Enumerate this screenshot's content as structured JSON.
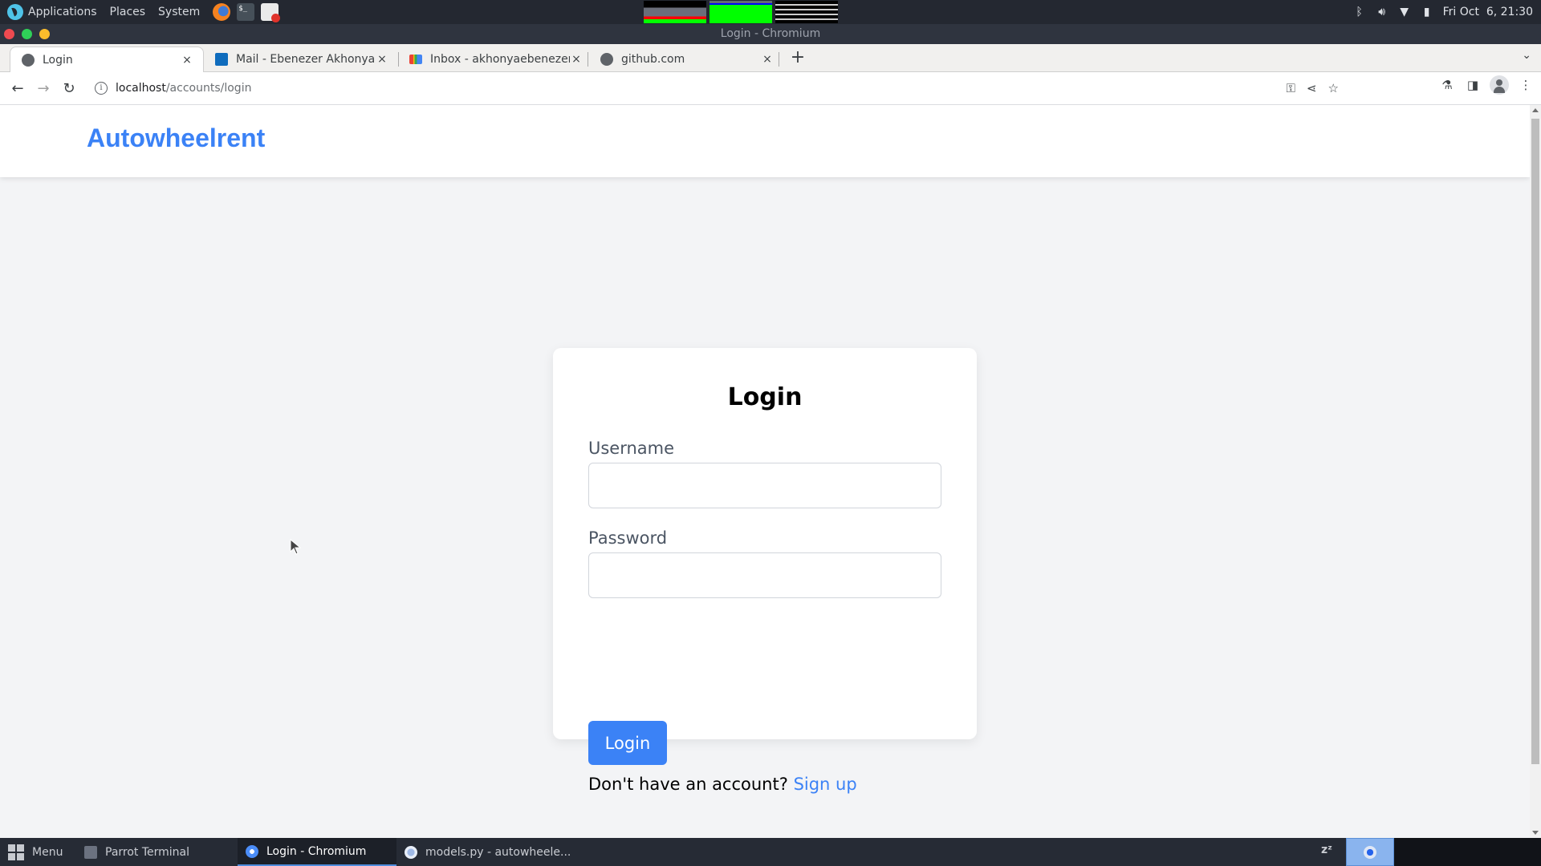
{
  "system_panel": {
    "menus": [
      "Applications",
      "Places",
      "System"
    ],
    "launchers": [
      "firefox-icon",
      "terminal-icon",
      "text-editor-icon"
    ],
    "terminal_glyph": "$_",
    "clock": "Fri Oct  6, 21:30"
  },
  "window": {
    "title": "Login - Chromium"
  },
  "tabs": [
    {
      "title": "Login",
      "favicon": "globe-icon",
      "active": true
    },
    {
      "title": "Mail - Ebenezer Akhonya",
      "favicon": "outlook-icon",
      "active": false
    },
    {
      "title": "Inbox - akhonyaebenezer",
      "favicon": "gmail-icon",
      "active": false
    },
    {
      "title": "github.com",
      "favicon": "globe-icon",
      "active": false
    }
  ],
  "tab_close_glyph": "×",
  "new_tab_glyph": "+",
  "tab_search_glyph": "⌄",
  "address_bar": {
    "host": "localhost",
    "path": "/accounts/login",
    "info_glyph": "i"
  },
  "nav": {
    "back": "←",
    "forward": "→",
    "reload": "↻"
  },
  "omnibox_icons": {
    "key": "⚿",
    "share": "⋖",
    "star": "☆"
  },
  "toolbar_icons": {
    "labs": "⚗",
    "side_panel": "◨",
    "menu": "⋮"
  },
  "page": {
    "brand": "Autowheelrent",
    "heading": "Login",
    "username_label": "Username",
    "username_value": "",
    "password_label": "Password",
    "password_value": "",
    "submit_label": "Login",
    "signup_prompt": "Don't have an account?",
    "signup_link": "Sign up",
    "colors": {
      "accent": "#3b82f6",
      "background": "#f3f4f6",
      "card": "#ffffff"
    }
  },
  "taskbar": {
    "menu_label": "Menu",
    "tasks": [
      {
        "label": "Parrot Terminal",
        "active": false
      },
      {
        "label": "Login - Chromium",
        "active": true
      },
      {
        "label": "models.py - autowheele...",
        "active": false
      }
    ],
    "sleep_glyph": "zᶻ"
  }
}
